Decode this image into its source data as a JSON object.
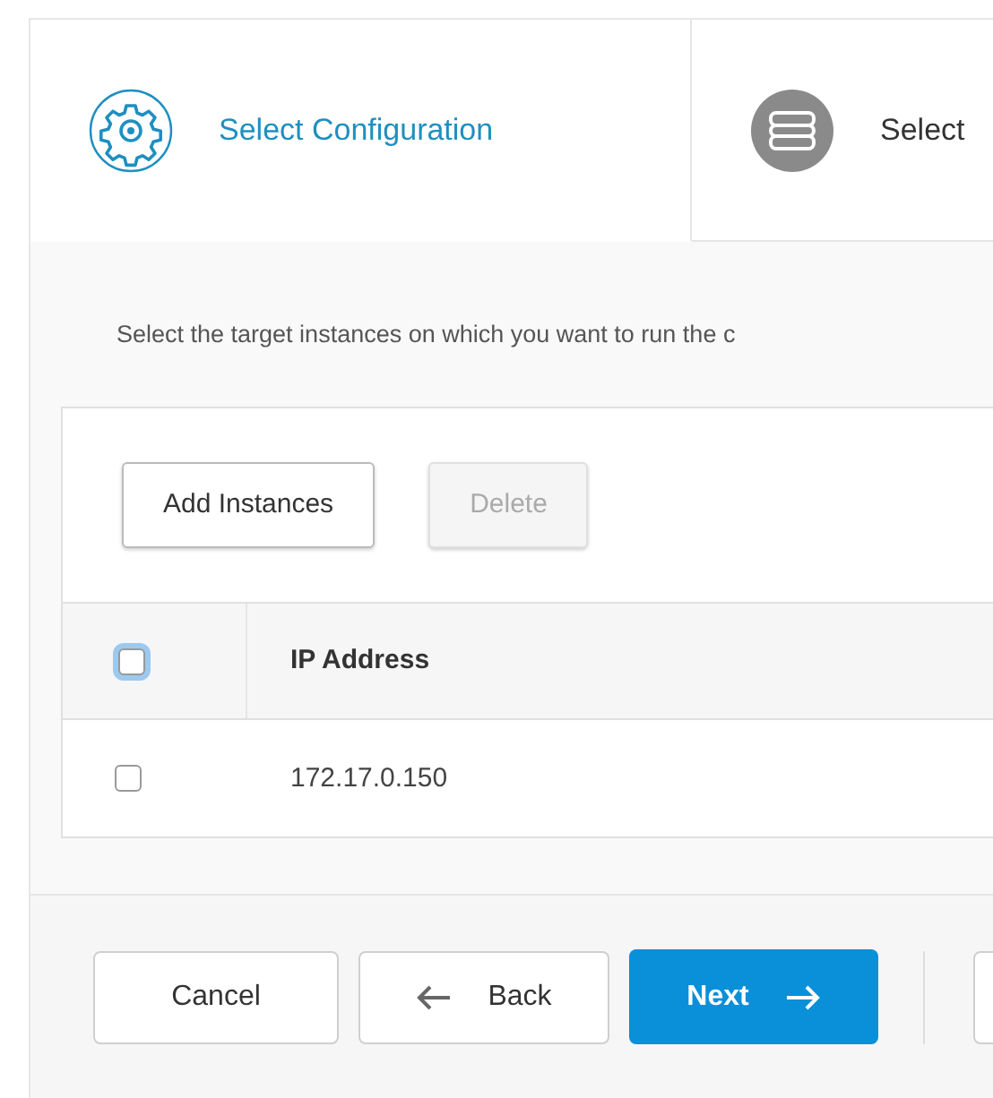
{
  "steps": [
    {
      "label": "Select Configuration",
      "kind": "gear",
      "selected": true
    },
    {
      "label": "Select",
      "kind": "server",
      "selected": false
    }
  ],
  "description": "Select the target instances on which you want to run the c",
  "toolbar": [
    {
      "label": "Add Instances",
      "disabled": false
    },
    {
      "label": "Delete",
      "disabled": true
    }
  ],
  "table": {
    "select_all": {
      "checked": false,
      "focused": true
    },
    "columns": [
      "IP Address"
    ],
    "rows": [
      {
        "checked": false,
        "cells": [
          "172.17.0.150"
        ]
      }
    ]
  },
  "footer": [
    {
      "label": "Cancel",
      "kind": "plain"
    },
    {
      "label": "Back",
      "kind": "back"
    },
    {
      "label": "Next",
      "kind": "next"
    },
    {
      "kind": "cut"
    }
  ]
}
